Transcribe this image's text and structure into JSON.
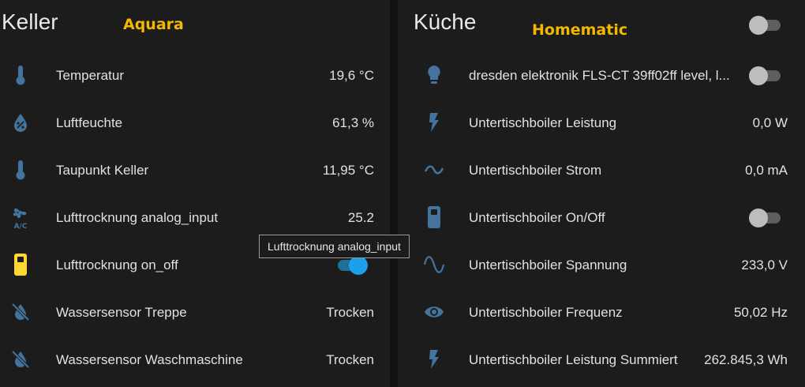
{
  "left_card": {
    "title": "Keller",
    "brand": "Aquara",
    "rows": [
      {
        "label": "Temperatur",
        "value": "19,6 °C",
        "icon": "thermometer-icon"
      },
      {
        "label": "Luftfeuchte",
        "value": "61,3 %",
        "icon": "water-percent-icon"
      },
      {
        "label": "Taupunkt Keller",
        "value": "11,95 °C",
        "icon": "thermometer-icon"
      },
      {
        "label": "Lufttrocknung analog_input",
        "value": "25.2",
        "icon": "air-conditioner-icon"
      },
      {
        "label": "Lufttrocknung on_off",
        "toggle": true,
        "icon": "switch-icon"
      },
      {
        "label": "Wassersensor Treppe",
        "value": "Trocken",
        "icon": "water-off-icon"
      },
      {
        "label": "Wassersensor Waschmaschine",
        "value": "Trocken",
        "icon": "water-off-icon"
      }
    ]
  },
  "right_card": {
    "title": "Küche",
    "brand": "Homematic",
    "header_toggle": false,
    "rows": [
      {
        "label": "dresden elektronik FLS-CT 39ff02ff level, l...",
        "toggle": false,
        "icon": "lightbulb-icon"
      },
      {
        "label": "Untertischboiler Leistung",
        "value": "0,0 W",
        "icon": "flash-icon"
      },
      {
        "label": "Untertischboiler Strom",
        "value": "0,0 mA",
        "icon": "current-ac-icon"
      },
      {
        "label": "Untertischboiler On/Off",
        "toggle": false,
        "icon": "switch-icon"
      },
      {
        "label": "Untertischboiler Spannung",
        "value": "233,0 V",
        "icon": "sine-wave-icon"
      },
      {
        "label": "Untertischboiler Frequenz",
        "value": "50,02 Hz",
        "icon": "eye-icon"
      },
      {
        "label": "Untertischboiler Leistung Summiert",
        "value": "262.845,3 Wh",
        "icon": "flash-icon"
      }
    ]
  },
  "tooltip": {
    "text": "Lufttrocknung analog_input"
  },
  "colors": {
    "icon": "#44739e",
    "switch_icon_on": "#fdd835",
    "toggle_on": "#1aa0ec",
    "brand": "#f5b800"
  }
}
